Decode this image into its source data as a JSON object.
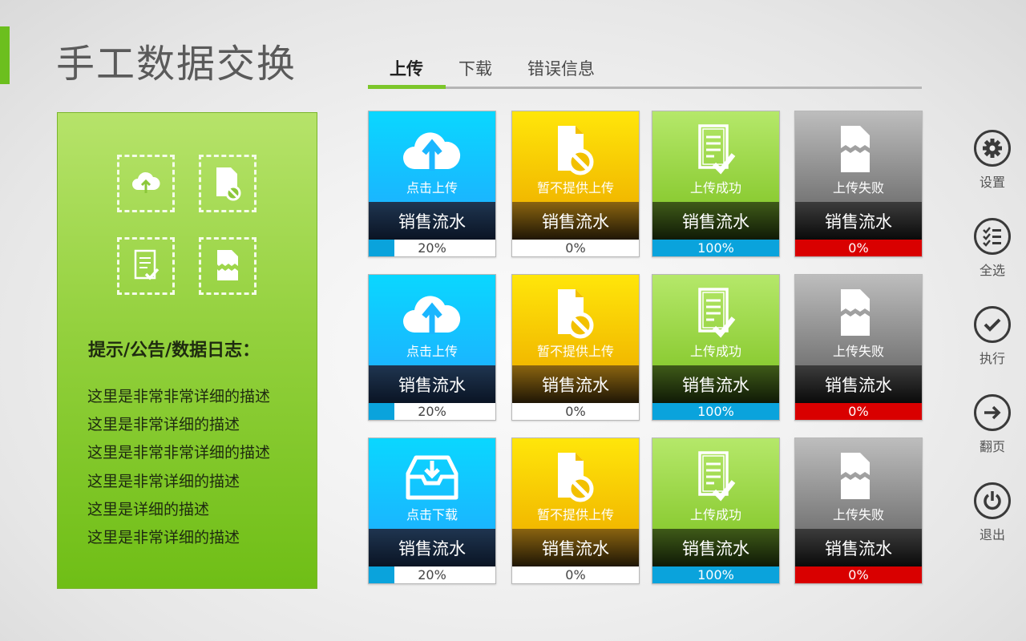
{
  "header": {
    "title": "手工数据交换"
  },
  "tabs": [
    {
      "label": "上传",
      "active": true
    },
    {
      "label": "下载",
      "active": false
    },
    {
      "label": "错误信息",
      "active": false
    }
  ],
  "info_panel": {
    "heading": "提示/公告/数据日志：",
    "icons": [
      "cloud-upload-icon",
      "file-blocked-icon",
      "document-check-icon",
      "file-broken-icon"
    ],
    "lines": [
      "这里是非常非常详细的描述",
      "这里是非常详细的描述",
      "这里是非常非常详细的描述",
      "这里是非常详细的描述",
      "这里是详细的描述",
      "这里是非常详细的描述"
    ]
  },
  "cards": [
    [
      {
        "theme": "blue",
        "icon": "cloud-upload-icon",
        "status": "点击上传",
        "title": "销售流水",
        "progress": 20,
        "pct_label": "20%",
        "fill_color": "#0aa3dc"
      },
      {
        "theme": "yellow",
        "icon": "file-blocked-icon",
        "status": "暂不提供上传",
        "title": "销售流水",
        "progress": 0,
        "pct_label": "0%",
        "fill_color": "#ffffff"
      },
      {
        "theme": "green",
        "icon": "document-check-icon",
        "status": "上传成功",
        "title": "销售流水",
        "progress": 100,
        "pct_label": "100%",
        "fill_color": "#0aa3dc"
      },
      {
        "theme": "gray",
        "icon": "file-broken-icon",
        "status": "上传失败",
        "title": "销售流水",
        "progress": 100,
        "pct_label": "0%",
        "fill_color": "#d90000"
      }
    ],
    [
      {
        "theme": "blue",
        "icon": "cloud-upload-icon",
        "status": "点击上传",
        "title": "销售流水",
        "progress": 20,
        "pct_label": "20%",
        "fill_color": "#0aa3dc"
      },
      {
        "theme": "yellow",
        "icon": "file-blocked-icon",
        "status": "暂不提供上传",
        "title": "销售流水",
        "progress": 0,
        "pct_label": "0%",
        "fill_color": "#ffffff"
      },
      {
        "theme": "green",
        "icon": "document-check-icon",
        "status": "上传成功",
        "title": "销售流水",
        "progress": 100,
        "pct_label": "100%",
        "fill_color": "#0aa3dc"
      },
      {
        "theme": "gray",
        "icon": "file-broken-icon",
        "status": "上传失败",
        "title": "销售流水",
        "progress": 100,
        "pct_label": "0%",
        "fill_color": "#d90000"
      }
    ],
    [
      {
        "theme": "blue",
        "icon": "inbox-download-icon",
        "status": "点击下载",
        "title": "销售流水",
        "progress": 20,
        "pct_label": "20%",
        "fill_color": "#0aa3dc"
      },
      {
        "theme": "yellow",
        "icon": "file-blocked-icon",
        "status": "暂不提供上传",
        "title": "销售流水",
        "progress": 0,
        "pct_label": "0%",
        "fill_color": "#ffffff"
      },
      {
        "theme": "green",
        "icon": "document-check-icon",
        "status": "上传成功",
        "title": "销售流水",
        "progress": 100,
        "pct_label": "100%",
        "fill_color": "#0aa3dc"
      },
      {
        "theme": "gray",
        "icon": "file-broken-icon",
        "status": "上传失败",
        "title": "销售流水",
        "progress": 100,
        "pct_label": "0%",
        "fill_color": "#d90000"
      }
    ]
  ],
  "side_actions": [
    {
      "label": "设置",
      "icon": "gear-icon"
    },
    {
      "label": "全选",
      "icon": "select-all-icon"
    },
    {
      "label": "执行",
      "icon": "check-icon"
    },
    {
      "label": "翻页",
      "icon": "arrow-right-icon"
    },
    {
      "label": "退出",
      "icon": "power-icon"
    }
  ],
  "colors": {
    "accent": "#6cbf1e",
    "progress_blue": "#0aa3dc",
    "fail_red": "#d90000"
  }
}
